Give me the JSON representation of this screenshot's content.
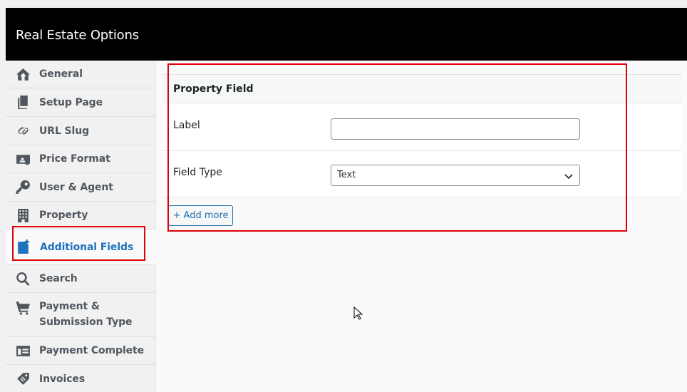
{
  "app": {
    "title": "Real Estate Options"
  },
  "sidebar": {
    "items": [
      {
        "label": "General",
        "icon": "home-group-icon"
      },
      {
        "label": "Setup Page",
        "icon": "pages-icon"
      },
      {
        "label": "URL Slug",
        "icon": "link-icon"
      },
      {
        "label": "Price Format",
        "icon": "money-card-icon"
      },
      {
        "label": "User & Agent",
        "icon": "key-icon"
      },
      {
        "label": "Property",
        "icon": "building-icon"
      },
      {
        "label": "Additional Fields",
        "icon": "document-add-icon",
        "active": true
      },
      {
        "label": "Search",
        "icon": "search-icon"
      },
      {
        "label": "Payment & Submission Type",
        "icon": "cart-icon"
      },
      {
        "label": "Payment Complete",
        "icon": "form-card-icon"
      },
      {
        "label": "Invoices",
        "icon": "tag-icon"
      }
    ]
  },
  "panel": {
    "title": "Property Field",
    "label_field": {
      "label": "Label",
      "value": "",
      "placeholder": ""
    },
    "type_field": {
      "label": "Field Type",
      "value": "Text"
    }
  },
  "actions": {
    "add_more": "+ Add more"
  },
  "colors": {
    "accent": "#1e73be",
    "highlight": "#e0000a",
    "topbar": "#000000"
  }
}
